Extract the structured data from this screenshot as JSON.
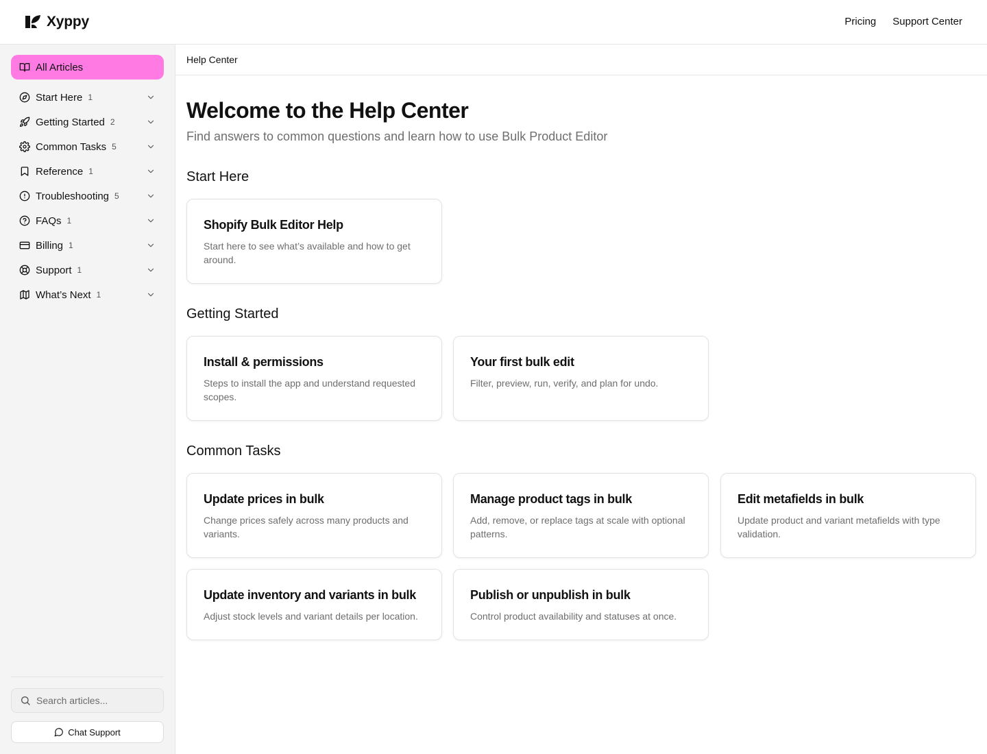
{
  "brand": {
    "name": "Xyppy"
  },
  "topnav": {
    "pricing": "Pricing",
    "support_center": "Support Center"
  },
  "sidebar": {
    "all_articles": "All Articles",
    "items": [
      {
        "label": "Start Here",
        "count": "1",
        "icon": "compass-icon"
      },
      {
        "label": "Getting Started",
        "count": "2",
        "icon": "rocket-icon"
      },
      {
        "label": "Common Tasks",
        "count": "5",
        "icon": "gear-icon"
      },
      {
        "label": "Reference",
        "count": "1",
        "icon": "bookmark-icon"
      },
      {
        "label": "Troubleshooting",
        "count": "5",
        "icon": "alert-circle-icon"
      },
      {
        "label": "FAQs",
        "count": "1",
        "icon": "help-circle-icon"
      },
      {
        "label": "Billing",
        "count": "1",
        "icon": "credit-card-icon"
      },
      {
        "label": "Support",
        "count": "1",
        "icon": "lifebuoy-icon"
      },
      {
        "label": "What’s Next",
        "count": "1",
        "icon": "map-icon"
      }
    ],
    "search_placeholder": "Search articles...",
    "chat_support": "Chat Support"
  },
  "breadcrumb": "Help Center",
  "hero": {
    "title": "Welcome to the Help Center",
    "subtitle": "Find answers to common questions and learn how to use Bulk Product Editor"
  },
  "sections": [
    {
      "title": "Start Here",
      "cards": [
        {
          "title": "Shopify Bulk Editor Help",
          "desc": "Start here to see what’s available and how to get around."
        }
      ]
    },
    {
      "title": "Getting Started",
      "cards": [
        {
          "title": "Install & permissions",
          "desc": "Steps to install the app and understand requested scopes."
        },
        {
          "title": "Your first bulk edit",
          "desc": "Filter, preview, run, verify, and plan for undo."
        }
      ]
    },
    {
      "title": "Common Tasks",
      "cards": [
        {
          "title": "Update prices in bulk",
          "desc": "Change prices safely across many products and variants."
        },
        {
          "title": "Manage product tags in bulk",
          "desc": "Add, remove, or replace tags at scale with optional patterns."
        },
        {
          "title": "Edit metafields in bulk",
          "desc": "Update product and variant metafields with type validation."
        },
        {
          "title": "Update inventory and variants in bulk",
          "desc": "Adjust stock levels and variant details per location."
        },
        {
          "title": "Publish or unpublish in bulk",
          "desc": "Control product availability and statuses at once."
        }
      ]
    }
  ],
  "colors": {
    "accent": "#ff7be3",
    "sidebar_bg": "#f4f4f4",
    "muted_text": "#6e6e6e"
  }
}
